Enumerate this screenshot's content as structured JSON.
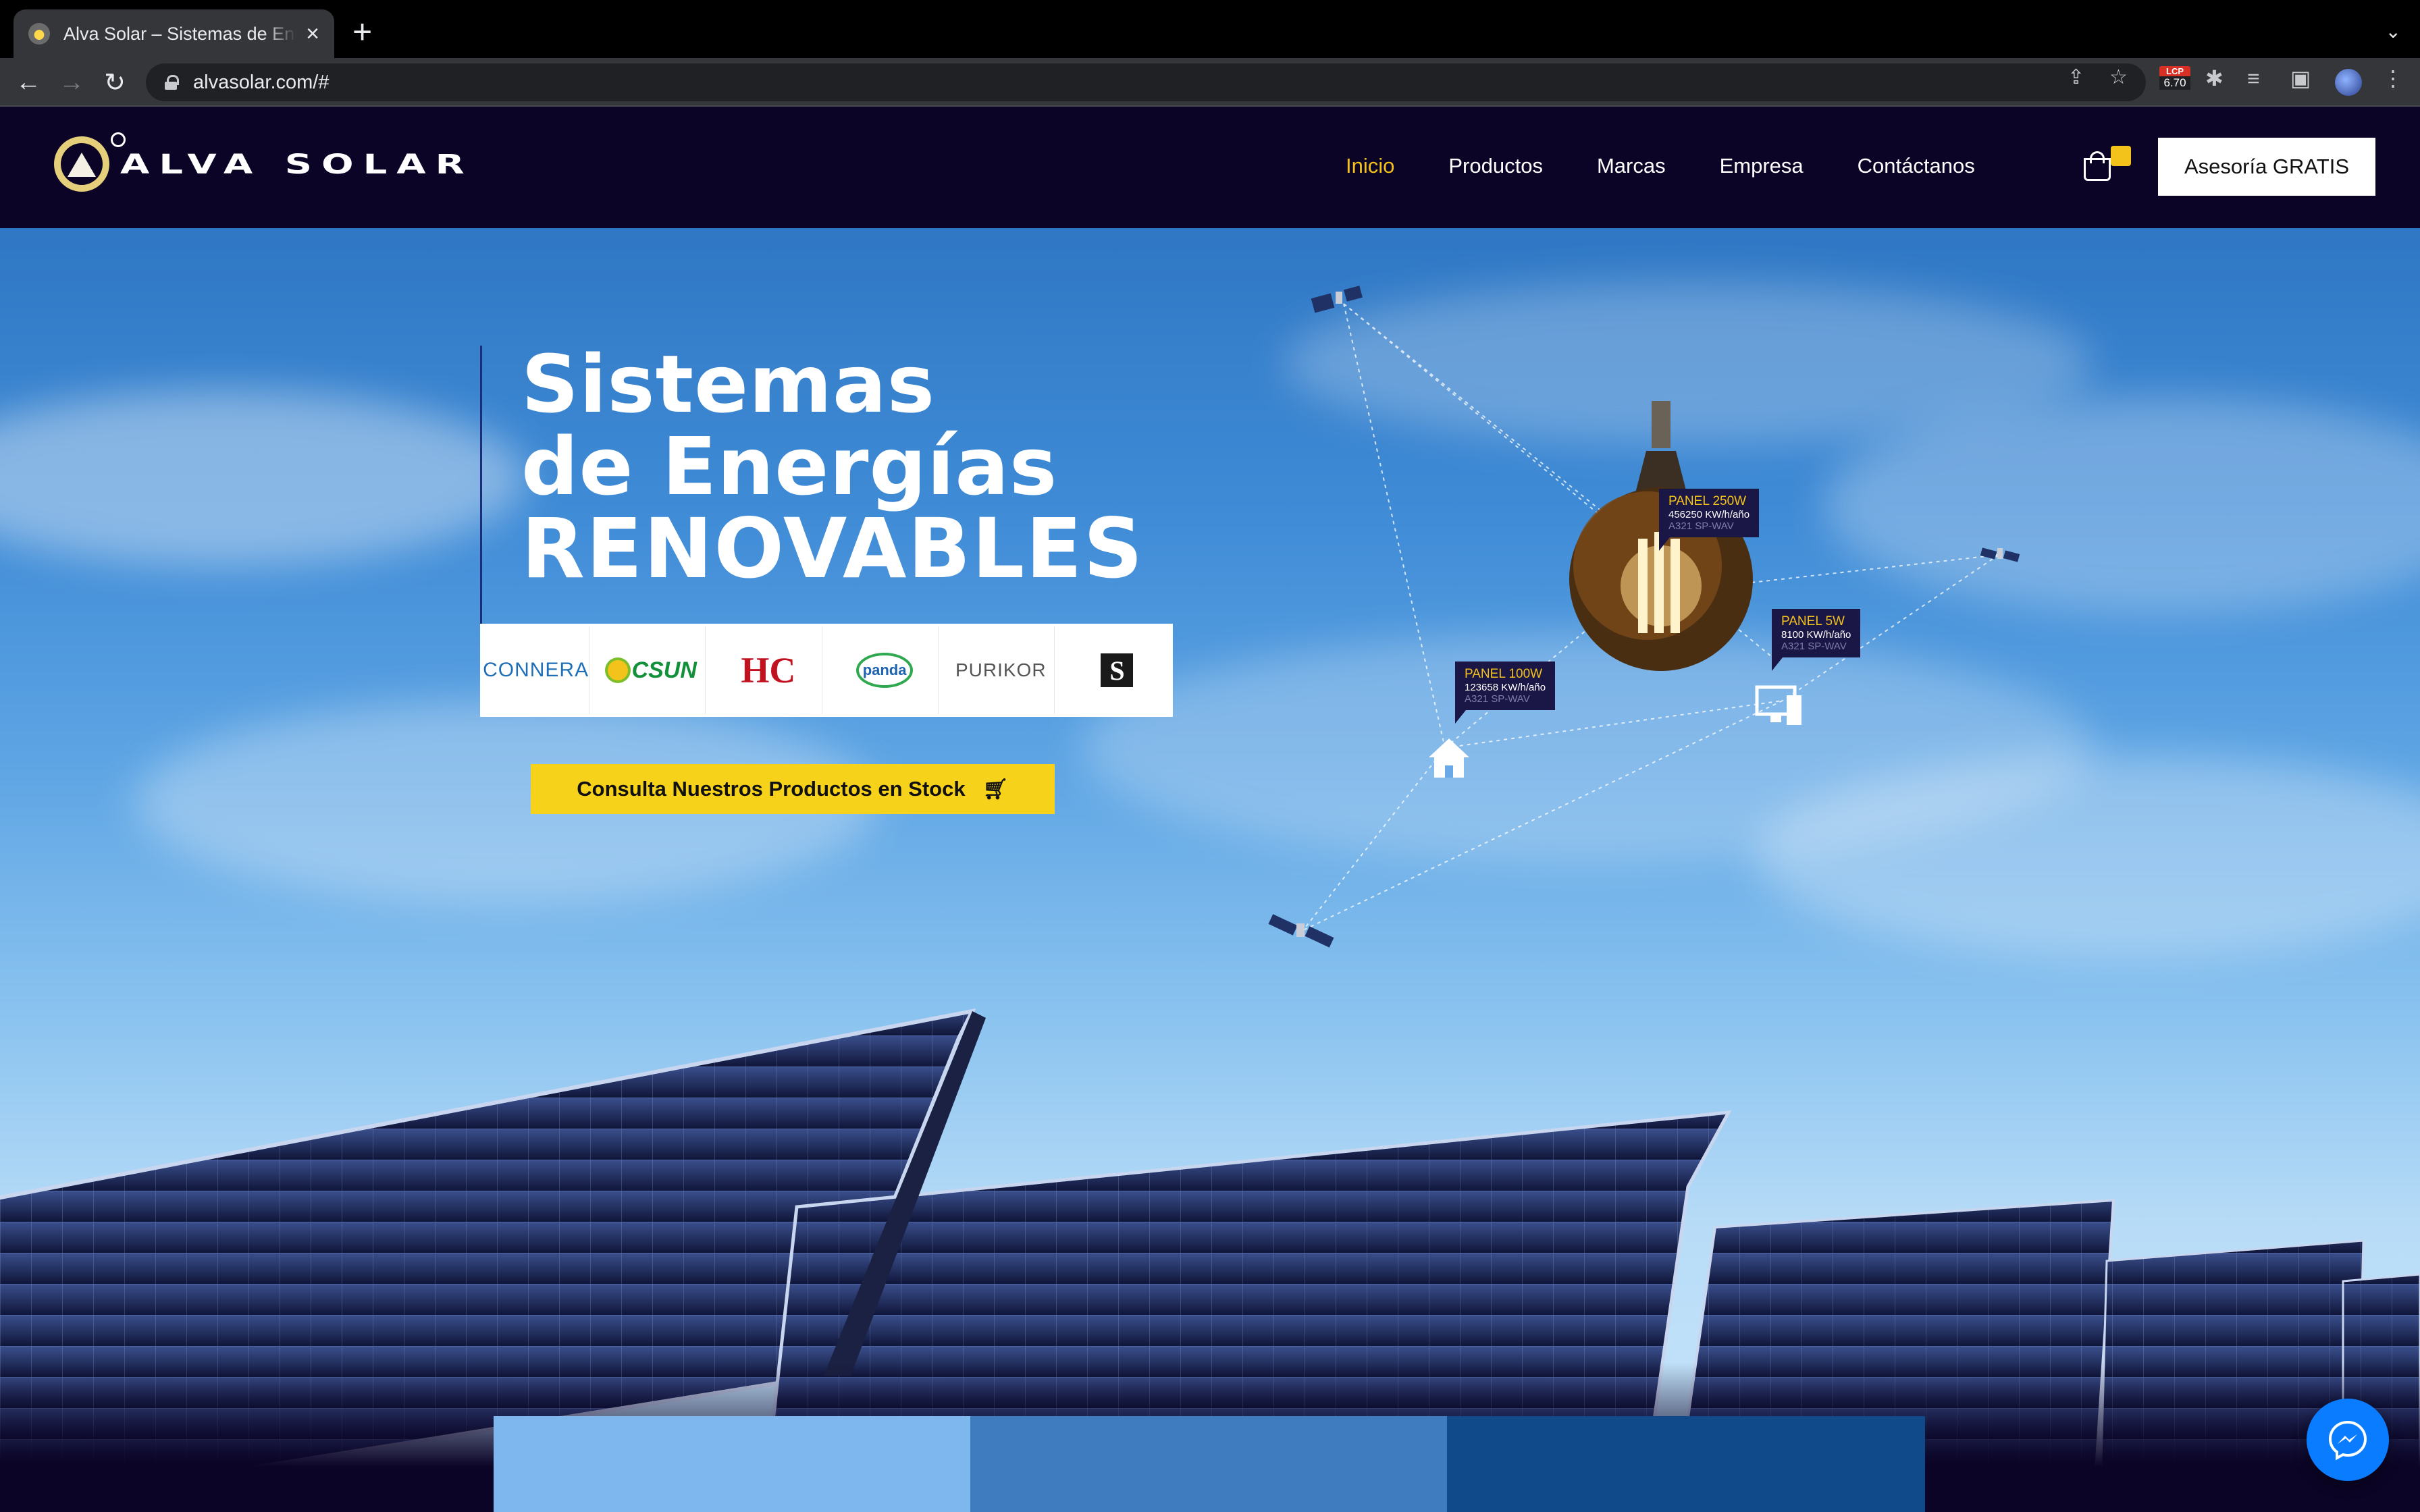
{
  "browser": {
    "tab_title": "Alva Solar – Sistemas de Energías Renovables",
    "url": "alvasolar.com/#",
    "lcp_label": "LCP",
    "lcp_value": "6.70"
  },
  "header": {
    "logo_text": "ALVA SOLAR",
    "nav": [
      "Inicio",
      "Productos",
      "Marcas",
      "Empresa",
      "Contáctanos"
    ],
    "active_nav": "Inicio",
    "cta_label": "Asesoría GRATIS"
  },
  "hero": {
    "headline_line1": "Sistemas",
    "headline_line2": "de Energías",
    "headline_line3": "RENOVABLES",
    "brands": [
      "CONNERA",
      "CSUN",
      "HC",
      "panda",
      "PURIKOR",
      "S"
    ],
    "stock_button_label": "Consulta Nuestros Productos en Stock"
  },
  "infographic": {
    "labels": [
      {
        "title": "PANEL 250W",
        "value": "456250 KW/h/año",
        "sub": "A321 SP-WAV"
      },
      {
        "title": "PANEL 5W",
        "value": "8100 KW/h/año",
        "sub": "A321 SP-WAV"
      },
      {
        "title": "PANEL 100W",
        "value": "123658 KW/h/año",
        "sub": "A321 SP-WAV"
      }
    ]
  },
  "colors": {
    "brand_dark": "#0b0426",
    "accent_yellow": "#f3c21b",
    "button_yellow": "#f7d21a",
    "bar_light": "#7eb6ee",
    "bar_mid": "#3f7bbf",
    "bar_dark": "#114a8a",
    "messenger_blue": "#0a7cff"
  },
  "icons": [
    "back-icon",
    "forward-icon",
    "reload-icon",
    "lock-icon",
    "share-icon",
    "star-icon",
    "extensions-icon",
    "reading-list-icon",
    "sidebar-icon",
    "menu-icon",
    "cart-icon",
    "messenger-icon",
    "home-icon",
    "computer-icon",
    "satellite-icon",
    "bulb-icon"
  ]
}
